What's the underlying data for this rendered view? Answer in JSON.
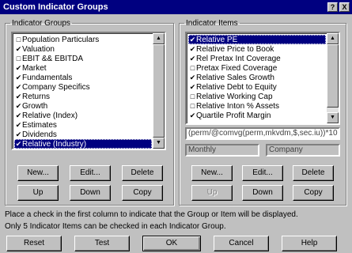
{
  "window": {
    "title": "Custom Indicator Groups",
    "help_btn": "?",
    "close_btn": "X"
  },
  "groups": {
    "legend": "Indicator Groups",
    "items": [
      {
        "checked": false,
        "label": "Population Particulars"
      },
      {
        "checked": true,
        "label": "Valuation"
      },
      {
        "checked": false,
        "label": "EBIT && EBITDA"
      },
      {
        "checked": true,
        "label": "Market"
      },
      {
        "checked": true,
        "label": "Fundamentals"
      },
      {
        "checked": true,
        "label": "Company Specifics"
      },
      {
        "checked": true,
        "label": "Returns"
      },
      {
        "checked": true,
        "label": "Growth"
      },
      {
        "checked": true,
        "label": "Relative (Index)"
      },
      {
        "checked": true,
        "label": "Estimates"
      },
      {
        "checked": true,
        "label": "Dividends"
      },
      {
        "checked": true,
        "label": "Relative (Industry)",
        "selected": true
      }
    ],
    "buttons": {
      "new": "New...",
      "edit": "Edit...",
      "delete": "Delete",
      "up": "Up",
      "down": "Down",
      "copy": "Copy"
    }
  },
  "items": {
    "legend": "Indicator Items",
    "items": [
      {
        "checked": true,
        "label": "Relative PE",
        "selected": true
      },
      {
        "checked": true,
        "label": "Relative Price to Book"
      },
      {
        "checked": true,
        "label": "Rel Pretax Int Coverage"
      },
      {
        "checked": false,
        "label": "Pretax Fixed Coverage"
      },
      {
        "checked": true,
        "label": "Relative Sales Growth"
      },
      {
        "checked": true,
        "label": "Relative Debt to Equity"
      },
      {
        "checked": false,
        "label": "Relative Working Cap"
      },
      {
        "checked": false,
        "label": "Relative Inton % Assets"
      },
      {
        "checked": true,
        "label": "Quartile Profit Margin"
      }
    ],
    "formula": "(perm/@comvg(perm,mkvdm,$,sec.iu))*10",
    "period": "Monthly",
    "scope": "Company",
    "buttons": {
      "new": "New...",
      "edit": "Edit...",
      "delete": "Delete",
      "up": "Up",
      "down": "Down",
      "copy": "Copy"
    }
  },
  "notes": {
    "line1": "Place a check in the first column to indicate that the Group or Item will be displayed.",
    "line2": "Only 5 Indicator Items can be checked in each Indicator Group."
  },
  "footer": {
    "reset": "Reset",
    "test": "Test",
    "ok": "OK",
    "cancel": "Cancel",
    "help": "Help"
  },
  "colors": {
    "titlebar": "#000080",
    "selection": "#000080",
    "face": "#c0c0c0"
  }
}
